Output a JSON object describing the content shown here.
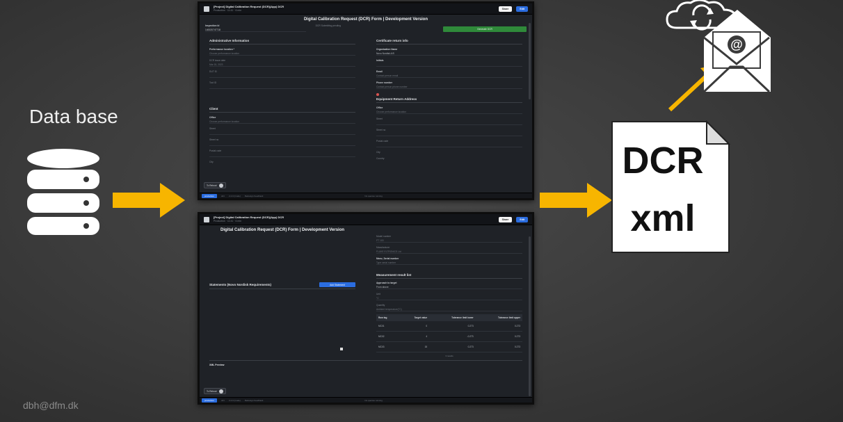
{
  "slide": {
    "db_label": "Data base",
    "footer_email": "dbh@dfm.dk",
    "dcr_line1": "DCR",
    "dcr_line2": "xml",
    "accent_color": "#f7b500"
  },
  "icons": {
    "database": "database-icon",
    "cloud_sync": "cloud-sync-icon",
    "email": "email-envelope-icon",
    "arrow": "arrow-right-icon"
  },
  "screen1": {
    "app_title": "[Project] Digital Calibration Request (DCR)(App) DCR",
    "app_subtitle": "Production · 11:41 · 6 min",
    "share": "Share",
    "edit": "Edit",
    "form_title": "Digital Calibration Request (DCR) Form | Development Version",
    "inspection_id_label": "Inspection Id",
    "inspection_id_value": "140020747718",
    "dcr_pending_label": "DCR Submitting pending",
    "generate_button": "Generate DCR",
    "admin": {
      "title": "Administrative Information",
      "performance_location_label": "Performance location *",
      "performance_location_placeholder": "Choose performance location",
      "date_label": "DCR issue date",
      "date_value": "Mar 15, 2023",
      "dut_label": "DUT ID",
      "tool_label": "Tool ID"
    },
    "cert_return": {
      "title": "Certificate return info",
      "org_label": "Organisation Name",
      "org_value": "Novo Nordisk A/S",
      "initials_label": "Initials",
      "email_label": "Email",
      "email_placeholder": "Contact person email",
      "phone_label": "Phone number",
      "phone_placeholder": "Contact person phone number"
    },
    "client": {
      "title": "Client",
      "office_label": "Office",
      "office_placeholder": "Choose performance location",
      "street_label": "Street",
      "street_no_label": "Street no",
      "postal_label": "Postal code",
      "city_label": "City"
    },
    "equipment_return": {
      "title": "Equipment Return Address",
      "office_label": "Office",
      "office_placeholder": "Choose performance location",
      "street_label": "Street",
      "street_no_label": "Street no",
      "postal_label": "Postal code",
      "city_label": "City",
      "country_label": "Country"
    },
    "reboot": "To Reboot",
    "status_env": "production",
    "status_items": [
      "dcrt",
      "2.4.0 (Code)",
      "Redesign Feedback"
    ],
    "status_right": "No queries running"
  },
  "screen2": {
    "app_title": "[Project] Digital Calibration Request (DCR)(App) DCR",
    "app_subtitle": "Production · 11:41 · 6 min",
    "share": "Share",
    "edit": "Edit",
    "form_title": "Digital Calibration Request (DCR) Form | Development Version",
    "model_label": "Model number",
    "model_value": "PT 100",
    "manufacturer_label": "Manufacturer",
    "manufacturer_value": "FLUKE ELTRONICS Ltd",
    "serial_label": "Manu_Serial number",
    "serial_placeholder": "Type serial number",
    "statements_title": "Statements (Novo Nordisk Requirements)",
    "add_statement": "Add Statement",
    "measurement_title": "Measurement result list",
    "approach_label": "Approach to target",
    "approach_value": "From above",
    "unit_label": "Unit",
    "unit_value": "°C",
    "quantity_label": "Quantity",
    "quantity_value": "Ambient temperature(°C)",
    "table": {
      "headers": [
        "Row tag",
        "Target value",
        "Tolerance limit lower",
        "Tolerance limit upper"
      ],
      "rows": [
        [
          "MC01",
          "0",
          "0.273",
          "0.273"
        ],
        [
          "MC02",
          "4",
          "-0.273",
          "0.273"
        ],
        [
          "MC03",
          "15",
          "0.273",
          "0.273"
        ]
      ],
      "footer": "3 results"
    },
    "xml_preview": "XML Preview",
    "reboot": "To Reboot",
    "status_env": "production",
    "status_items": [
      "dcrt",
      "2.4.0 (Code)",
      "Redesign Feedback"
    ],
    "status_right": "No queries running"
  }
}
